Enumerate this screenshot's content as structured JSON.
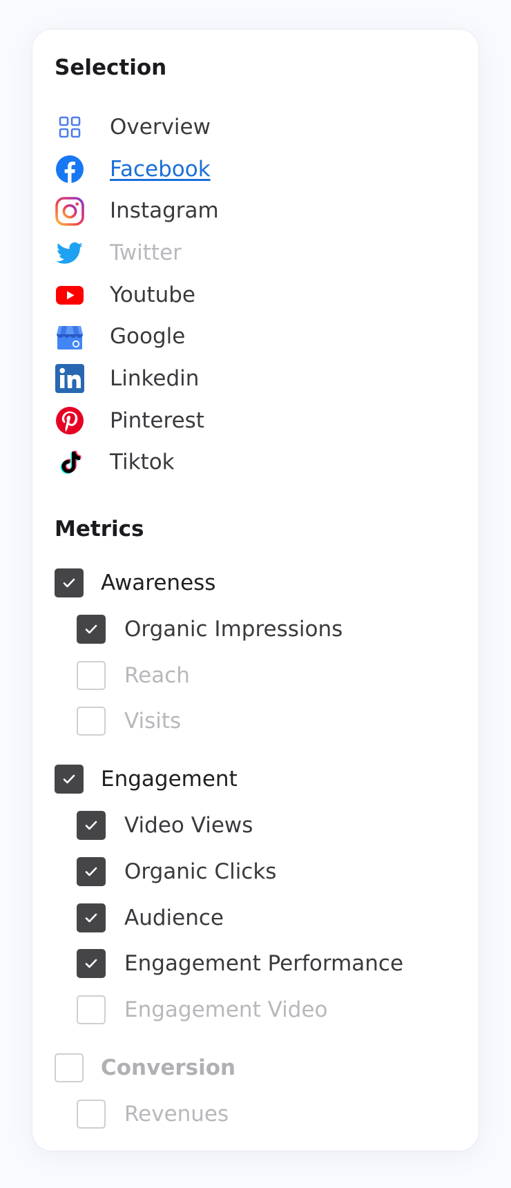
{
  "selection": {
    "title": "Selection",
    "items": [
      {
        "label": "Overview",
        "icon": "grid-icon",
        "state": "normal"
      },
      {
        "label": "Facebook",
        "icon": "facebook-icon",
        "state": "active"
      },
      {
        "label": "Instagram",
        "icon": "instagram-icon",
        "state": "normal"
      },
      {
        "label": "Twitter",
        "icon": "twitter-icon",
        "state": "disabled"
      },
      {
        "label": "Youtube",
        "icon": "youtube-icon",
        "state": "normal"
      },
      {
        "label": "Google",
        "icon": "google-my-business-icon",
        "state": "normal"
      },
      {
        "label": "Linkedin",
        "icon": "linkedin-icon",
        "state": "normal"
      },
      {
        "label": "Pinterest",
        "icon": "pinterest-icon",
        "state": "normal"
      },
      {
        "label": "Tiktok",
        "icon": "tiktok-icon",
        "state": "normal"
      }
    ]
  },
  "metrics": {
    "title": "Metrics",
    "groups": [
      {
        "label": "Awareness",
        "checked": true,
        "items": [
          {
            "label": "Organic Impressions",
            "checked": true
          },
          {
            "label": "Reach",
            "checked": false
          },
          {
            "label": "Visits",
            "checked": false
          }
        ]
      },
      {
        "label": "Engagement",
        "checked": true,
        "items": [
          {
            "label": "Video Views",
            "checked": true
          },
          {
            "label": "Organic Clicks",
            "checked": true
          },
          {
            "label": "Audience",
            "checked": true
          },
          {
            "label": "Engagement Performance",
            "checked": true
          },
          {
            "label": "Engagement Video",
            "checked": false
          }
        ]
      },
      {
        "label": "Conversion",
        "checked": false,
        "items": [
          {
            "label": "Revenues",
            "checked": false
          }
        ]
      }
    ]
  },
  "colors": {
    "active_link": "#1a6fd8",
    "checkbox_checked": "#454548",
    "checkbox_unchecked_border": "#cfcfd3",
    "disabled_text": "#b9b9bd",
    "facebook": "#1877f2",
    "twitter": "#1da1f2",
    "youtube": "#ff0000",
    "linkedin": "#2867b2",
    "pinterest": "#e60023"
  }
}
